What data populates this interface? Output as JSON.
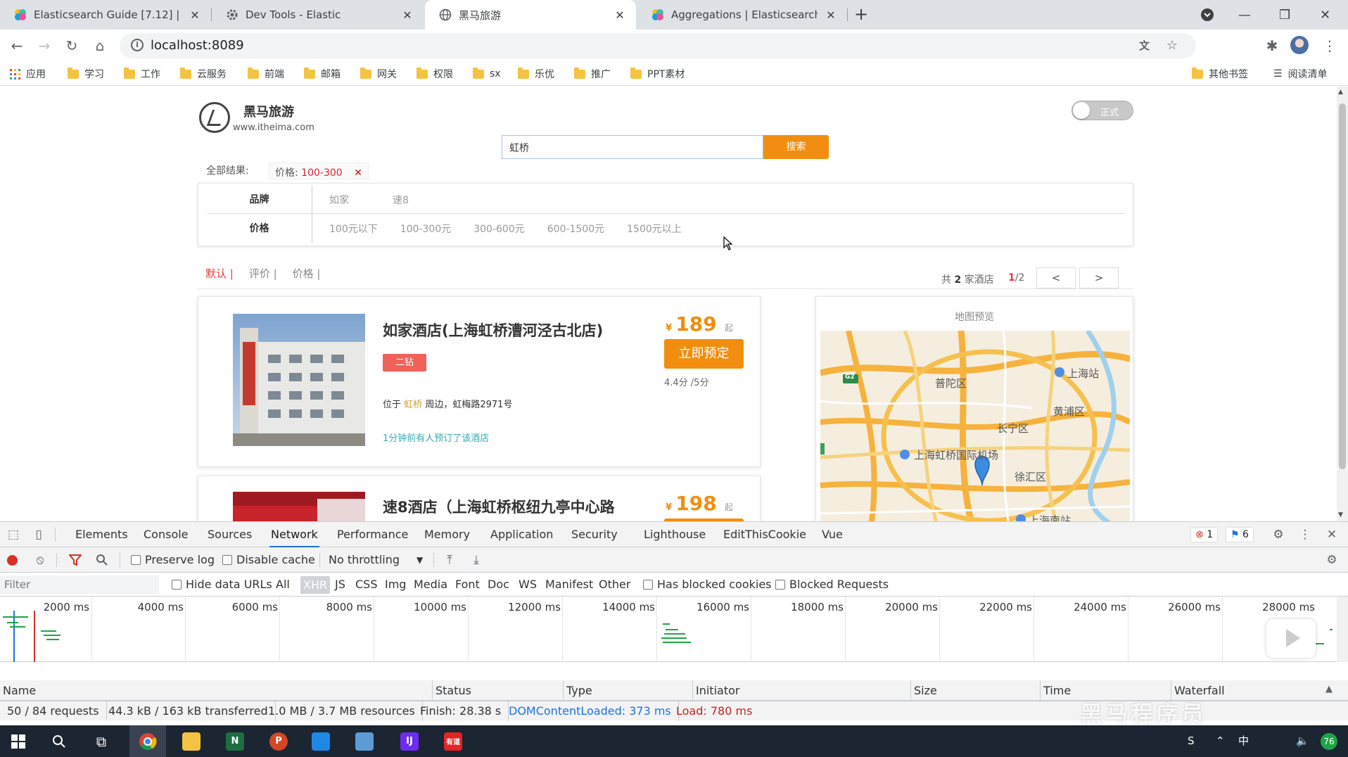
{
  "browser": {
    "tabs": [
      {
        "title": "Elasticsearch Guide [7.12] | Ela",
        "active": false
      },
      {
        "title": "Dev Tools - Elastic",
        "active": false
      },
      {
        "title": "黑马旅游",
        "active": true
      },
      {
        "title": "Aggregations | Elasticsearch G",
        "active": false
      }
    ],
    "url": "localhost:8089",
    "bookmarks": [
      "应用",
      "学习",
      "工作",
      "云服务",
      "前端",
      "邮箱",
      "网关",
      "权限",
      "sx",
      "乐优",
      "推广",
      "PPT素材"
    ],
    "bookmarks_right": [
      "其他书签",
      "阅读清单"
    ]
  },
  "page": {
    "brand": "黑马旅游",
    "brand_url": "www.itheima.com",
    "toggle_label": "正式",
    "search_value": "虹桥",
    "search_button": "搜索",
    "crumb_label": "全部结果:",
    "chip_key": "价格:",
    "chip_value": "100-300",
    "chip_remove": "✕",
    "filters": [
      {
        "key": "品牌",
        "values": [
          "如家",
          "速8"
        ]
      },
      {
        "key": "价格",
        "values": [
          "100元以下",
          "100-300元",
          "300-600元",
          "600-1500元",
          "1500元以上"
        ]
      }
    ],
    "sort": [
      {
        "label": "默认 |",
        "active": true
      },
      {
        "label": "评价 |",
        "active": false
      },
      {
        "label": "价格 |",
        "active": false
      }
    ],
    "count_prefix": "共",
    "count_num": "2",
    "count_suffix": "家酒店",
    "page_cur": "1",
    "page_total": "/2",
    "prev": "<",
    "next": ">",
    "hotels": [
      {
        "name": "如家酒店(上海虹桥漕河泾古北店)",
        "star": "二钻",
        "loc_prefix": "位于",
        "loc_keyword": "虹桥",
        "loc_suffix": "周边，虹梅路2971号",
        "recent": "1分钟前有人预订了该酒店",
        "currency": "¥",
        "price": "189",
        "qi": "起",
        "book": "立即预定",
        "score": "4.4分 /5分"
      },
      {
        "name": "速8酒店（上海虹桥枢纽九亭中心路",
        "currency": "¥",
        "price": "198",
        "qi": "起"
      }
    ],
    "map_title": "地图预览",
    "map_labels": [
      "上海站",
      "普陀区",
      "黄浦区",
      "长宁区",
      "上海虹桥国际机场",
      "徐汇区",
      "上海南站",
      "G2"
    ]
  },
  "devtools": {
    "tabs": [
      "Elements",
      "Console",
      "Sources",
      "Network",
      "Performance",
      "Memory",
      "Application",
      "Security",
      "Lighthouse",
      "EditThisCookie",
      "Vue"
    ],
    "active_tab": "Network",
    "errors": "1",
    "messages": "6",
    "preserve_log": "Preserve log",
    "disable_cache": "Disable cache",
    "throttling": "No throttling",
    "filter_placeholder": "Filter",
    "hide_data_urls": "Hide data URLs",
    "types": [
      "All",
      "XHR",
      "JS",
      "CSS",
      "Img",
      "Media",
      "Font",
      "Doc",
      "WS",
      "Manifest",
      "Other"
    ],
    "selected_type": "XHR",
    "has_blocked": "Has blocked cookies",
    "blocked_requests": "Blocked Requests",
    "timeline_labels": [
      "2000 ms",
      "4000 ms",
      "6000 ms",
      "8000 ms",
      "10000 ms",
      "12000 ms",
      "14000 ms",
      "16000 ms",
      "18000 ms",
      "20000 ms",
      "22000 ms",
      "24000 ms",
      "26000 ms",
      "28000 ms"
    ],
    "columns": [
      "Name",
      "Status",
      "Type",
      "Initiator",
      "Size",
      "Time",
      "Waterfall"
    ],
    "status": {
      "requests": "50 / 84 requests",
      "transferred": "44.3 kB / 163 kB transferred",
      "resources": "1.0 MB / 3.7 MB resources",
      "finish": "Finish: 28.38 s",
      "dcl": "DOMContentLoaded: 373 ms",
      "load": "Load: 780 ms"
    },
    "watermark": "黑马程序员"
  },
  "taskbar": {
    "tray_badge": "76",
    "tray_ime": "中"
  },
  "colors": {
    "accent_orange": "#f18e0f",
    "active_red": "#e4393c",
    "devtools_blue": "#1a73e8",
    "star_badge": "#f0615a"
  }
}
